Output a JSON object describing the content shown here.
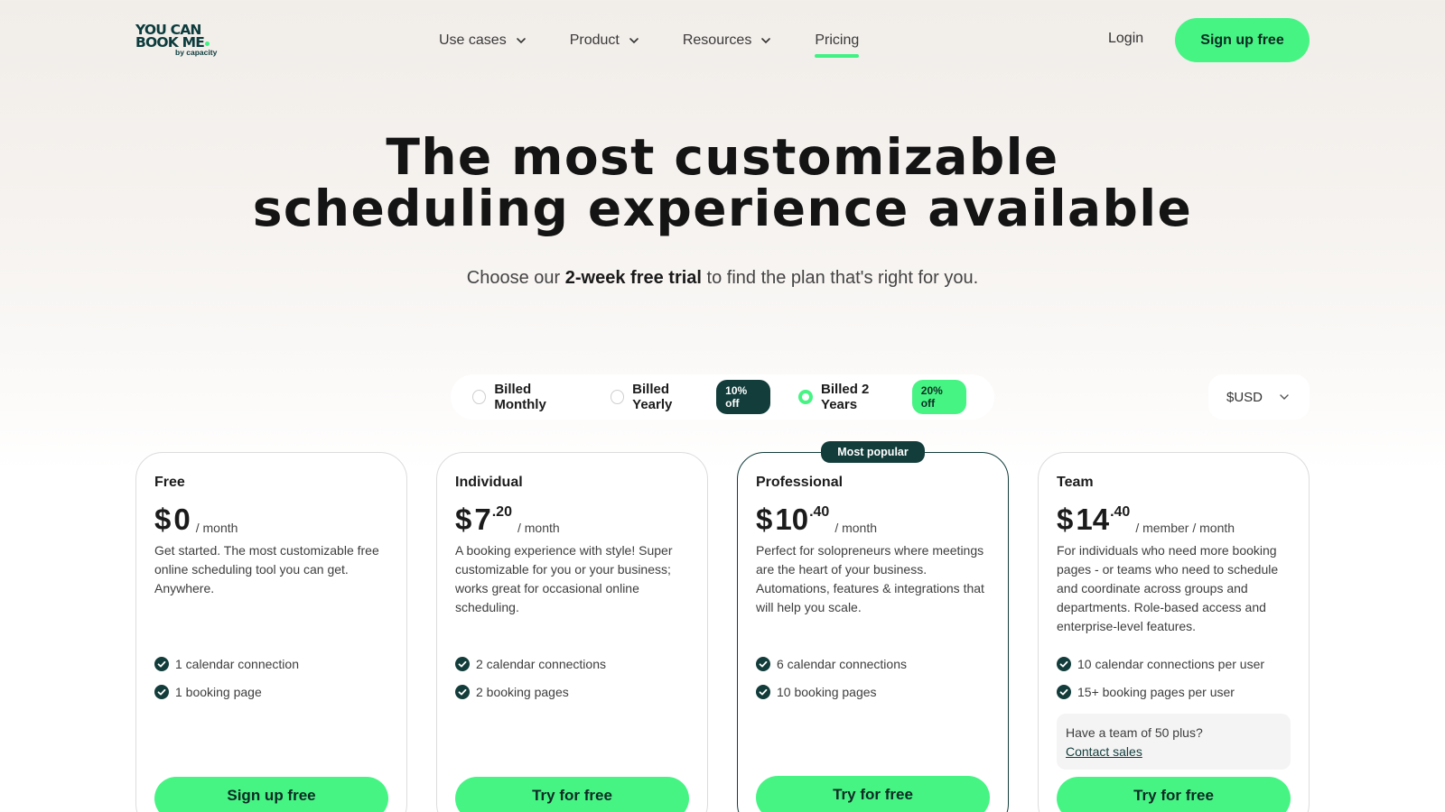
{
  "logo": {
    "line1": "YOU CAN",
    "line2": "BOOK ME",
    "sub": "by capacity"
  },
  "nav": {
    "items": [
      {
        "label": "Use cases",
        "dropdown": true
      },
      {
        "label": "Product",
        "dropdown": true
      },
      {
        "label": "Resources",
        "dropdown": true
      },
      {
        "label": "Pricing",
        "dropdown": false,
        "active": true
      }
    ],
    "login": "Login",
    "signup": "Sign up free"
  },
  "hero": {
    "title_line1": "The most customizable",
    "title_line2": "scheduling experience available",
    "sub_pre": "Choose our ",
    "sub_bold": "2-week free trial",
    "sub_post": " to find the plan that's right for you."
  },
  "billing": {
    "options": [
      {
        "label": "Billed Monthly",
        "badge": "",
        "selected": false
      },
      {
        "label": "Billed Yearly",
        "badge": "10% off",
        "selected": false
      },
      {
        "label": "Billed 2 Years",
        "badge": "20% off",
        "selected": true
      }
    ],
    "currency": "$USD"
  },
  "popular_label": "Most popular",
  "plans": [
    {
      "name": "Free",
      "currency": "$",
      "amount": "0",
      "cents": "",
      "period": "/ month",
      "description": "Get started. The most customizable free online scheduling tool you can get. Anywhere.",
      "features": [
        "1 calendar connection",
        "1 booking page"
      ],
      "cta": "Sign up free"
    },
    {
      "name": "Individual",
      "currency": "$",
      "amount": "7",
      "cents": ".20",
      "period": "/ month",
      "description": "A booking experience with style! Super customizable for you or your business; works great for occasional online scheduling.",
      "features": [
        "2 calendar connections",
        "2 booking pages"
      ],
      "cta": "Try for free"
    },
    {
      "name": "Professional",
      "currency": "$",
      "amount": "10",
      "cents": ".40",
      "period": "/ month",
      "description": "Perfect for solopreneurs where meetings are the heart of your business. Automations, features & integrations that will help you scale.",
      "features": [
        "6 calendar connections",
        "10 booking pages"
      ],
      "cta": "Try for free"
    },
    {
      "name": "Team",
      "currency": "$",
      "amount": "14",
      "cents": ".40",
      "period": "/ member / month",
      "description": "For individuals who need more booking pages - or teams who need to schedule and coordinate across groups and departments. Role-based access and enterprise-level features.",
      "features": [
        "10 calendar connections per user",
        "15+ booking pages per user"
      ],
      "sales_question": "Have a team of 50 plus?",
      "sales_link": "Contact sales",
      "cta": "Try for free"
    }
  ],
  "colors": {
    "accent": "#46f483",
    "dark": "#123d3b"
  },
  "icons": {
    "dropdown": "chevron-down-icon",
    "feature": "check-circle-icon"
  }
}
